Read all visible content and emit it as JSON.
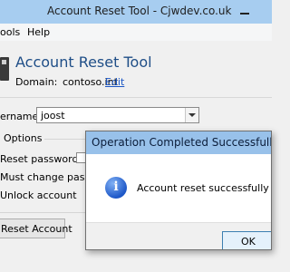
{
  "window": {
    "title": "Account Reset Tool - Cjwdev.co.uk"
  },
  "menubar": {
    "items": [
      "ools",
      "Help"
    ]
  },
  "header": {
    "app_title": "Account Reset Tool",
    "domain_label": "Domain:",
    "domain_value": "contoso.int",
    "edit_link": "Edit"
  },
  "form": {
    "username_label": "ername:",
    "username_value": "joost",
    "options_legend": "Options",
    "reset_password_label": "Reset password:",
    "must_change_label": "Must change passw",
    "unlock_label": "Unlock account",
    "reset_button": "Reset Account"
  },
  "dialog": {
    "title": "Operation Completed Successfully",
    "message": "Account reset successfully",
    "ok_button": "OK"
  }
}
